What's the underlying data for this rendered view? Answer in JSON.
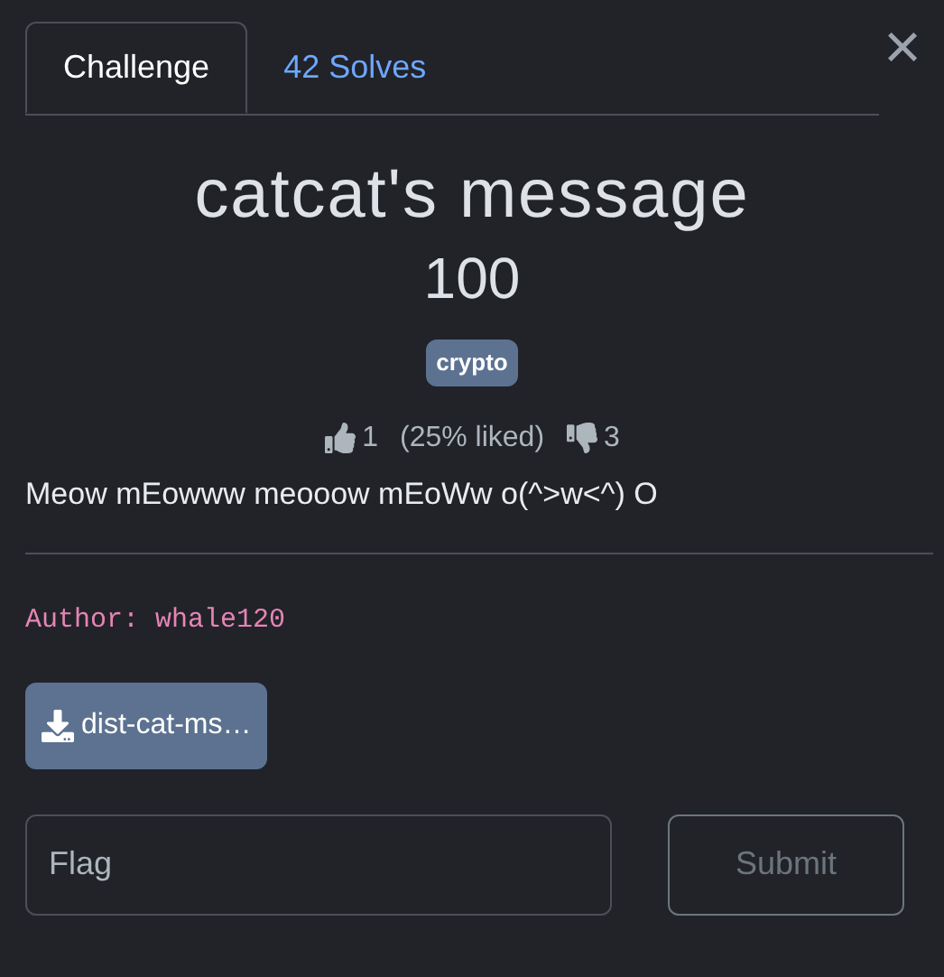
{
  "tabs": [
    {
      "label": "Challenge",
      "selected": true
    },
    {
      "label": "42 Solves",
      "selected": false
    }
  ],
  "close": "×",
  "challenge": {
    "name": "catcat's message",
    "value": "100",
    "tags": [
      "crypto"
    ],
    "votes": {
      "likes": "1",
      "ratio": "(25% liked)",
      "dislikes": "3"
    },
    "description": "Meow mEowww meooow mEoWw o(^>w<^) O",
    "author": "Author: whale120",
    "files": [
      "dist-cat-ms…"
    ]
  },
  "flag": {
    "placeholder": "Flag"
  },
  "submit": {
    "label": "Submit"
  }
}
